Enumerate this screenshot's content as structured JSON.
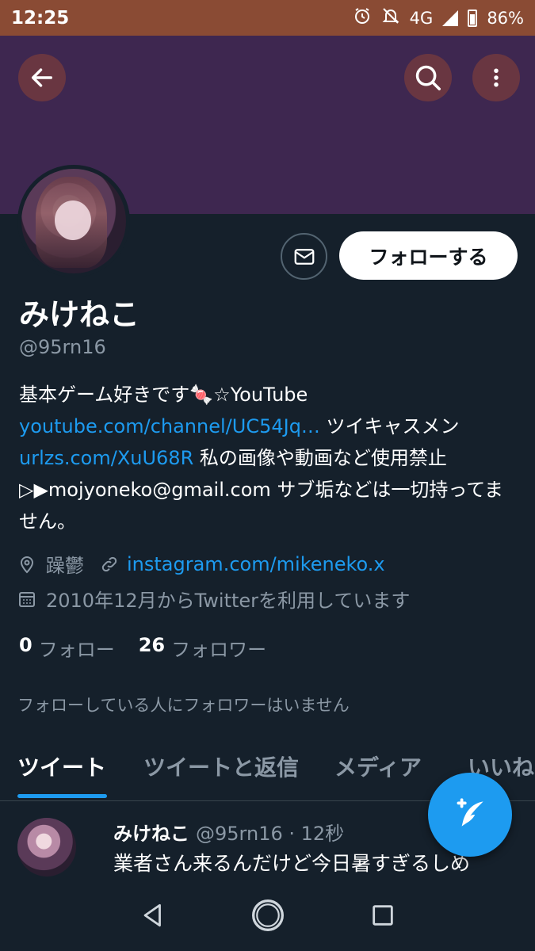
{
  "status_bar": {
    "time": "12:25",
    "network": "4G",
    "battery": "86%"
  },
  "profile": {
    "display_name": "みけねこ",
    "handle": "@95rn16",
    "follow_button": "フォローする",
    "bio": {
      "part1": "基本ゲーム好きです",
      "emoji": "🍬",
      "part2": "☆YouTube ",
      "link1": "youtube.com/channel/UC54Jq…",
      "part3": " ツイキャスメン",
      "link2": "urlzs.com/XuU68R",
      "part4": " 私の画像や動画など使用禁止▷▶mojyoneko@gmail.com サブ垢などは一切持ってません。"
    },
    "location": "躁鬱",
    "website": "instagram.com/mikeneko.x",
    "joined": "2010年12月からTwitterを利用しています",
    "following_count": "0",
    "following_label": "フォロー",
    "followers_count": "26",
    "followers_label": "フォロワー",
    "no_mutual_text": "フォローしている人にフォロワーはいません"
  },
  "tabs": [
    {
      "label": "ツイート",
      "active": true
    },
    {
      "label": "ツイートと返信",
      "active": false
    },
    {
      "label": "メディア",
      "active": false
    },
    {
      "label": "いいね",
      "active": false
    }
  ],
  "tweet": {
    "name": "みけねこ",
    "meta": "@95rn16 · 12秒",
    "text": "業者さん来るんだけど今日暑すぎるしめ"
  },
  "icons": {
    "back": "arrow-left-icon",
    "search": "search-icon",
    "more": "more-vertical-icon",
    "mail": "mail-icon",
    "location": "location-pin-icon",
    "link": "link-icon",
    "calendar": "calendar-icon",
    "compose": "compose-tweet-icon"
  },
  "colors": {
    "accent": "#1d9bf0",
    "background": "#15202b",
    "banner": "#3e2750",
    "status_bar": "#8a4b34"
  }
}
